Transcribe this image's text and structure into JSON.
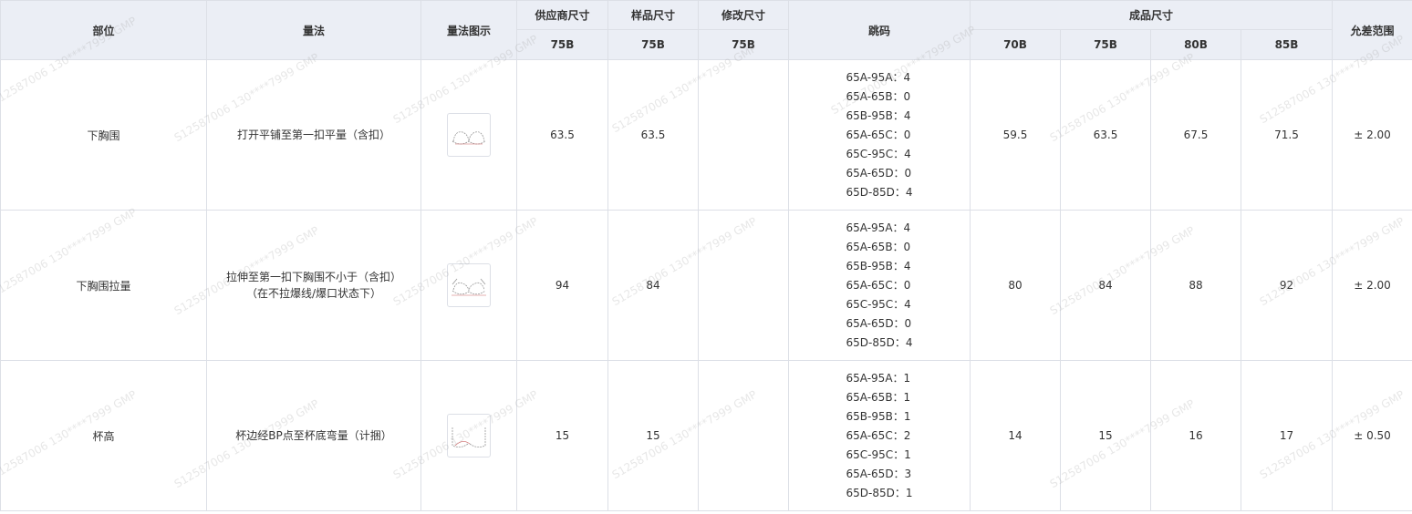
{
  "headers": {
    "part": "部位",
    "method": "量法",
    "diagram": "量法图示",
    "supplier": "供应商尺寸",
    "sample": "样品尺寸",
    "modified": "修改尺寸",
    "jump": "跳码",
    "finished": "成品尺寸",
    "tolerance": "允差范围",
    "supplier_size": "75B",
    "sample_size": "75B",
    "modified_size": "75B",
    "finished_sizes": [
      "70B",
      "75B",
      "80B",
      "85B"
    ]
  },
  "rows": [
    {
      "part": "下胸围",
      "method": "打开平铺至第一扣平量（含扣）",
      "diagram_icon": "bra-band-diagram",
      "supplier": "63.5",
      "sample": "63.5",
      "modified": "",
      "jump": [
        "65A-95A：4",
        "65A-65B：0",
        "65B-95B：4",
        "65A-65C：0",
        "65C-95C：4",
        "65A-65D：0",
        "65D-85D：4"
      ],
      "finished": [
        "59.5",
        "63.5",
        "67.5",
        "71.5"
      ],
      "tolerance": "± 2.00"
    },
    {
      "part": "下胸围拉量",
      "method": "拉伸至第一扣下胸围不小于（含扣）（在不拉爆线/爆口状态下）",
      "diagram_icon": "bra-stretch-diagram",
      "supplier": "94",
      "sample": "84",
      "modified": "",
      "jump": [
        "65A-95A：4",
        "65A-65B：0",
        "65B-95B：4",
        "65A-65C：0",
        "65C-95C：4",
        "65A-65D：0",
        "65D-85D：4"
      ],
      "finished": [
        "80",
        "84",
        "88",
        "92"
      ],
      "tolerance": "± 2.00"
    },
    {
      "part": "杯高",
      "method": "杯边经BP点至杯底弯量（计捆）",
      "diagram_icon": "cup-height-diagram",
      "supplier": "15",
      "sample": "15",
      "modified": "",
      "jump": [
        "65A-95A：1",
        "65A-65B：1",
        "65B-95B：1",
        "65A-65C：2",
        "65C-95C：1",
        "65A-65D：3",
        "65D-85D：1"
      ],
      "finished": [
        "14",
        "15",
        "16",
        "17"
      ],
      "tolerance": "± 0.50"
    }
  ],
  "watermark": "S12587006 130****7999 GMP",
  "colors": {
    "header_bg": "#ebeef5",
    "border": "#dcdfe6",
    "text": "#333333"
  }
}
